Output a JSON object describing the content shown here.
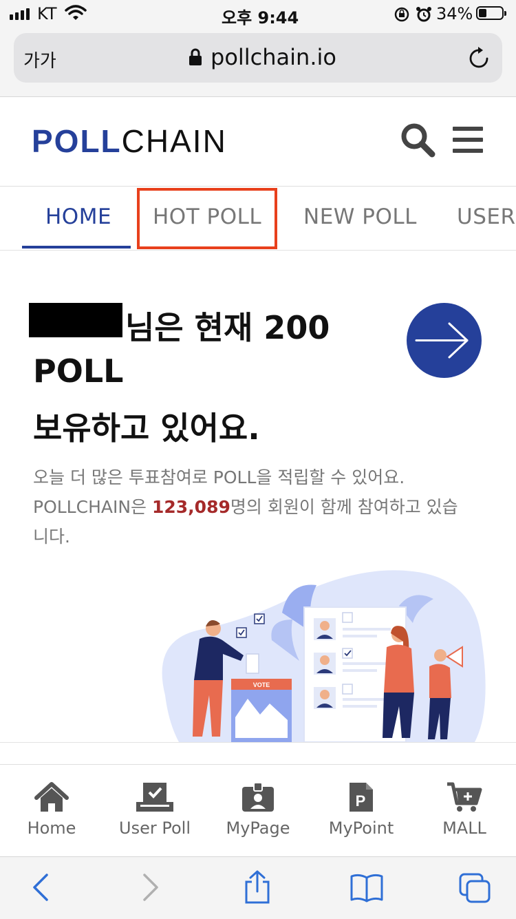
{
  "status_bar": {
    "carrier": "KT",
    "time": "오후 9:44",
    "battery_percent": "34%",
    "battery_level": 0.34
  },
  "browser": {
    "text_size_label": "가가",
    "url": "pollchain.io"
  },
  "site": {
    "logo_strong": "POLL",
    "logo_light": "CHAIN",
    "brand_color": "#25409a"
  },
  "tabs": [
    {
      "label": "HOME",
      "active": true
    },
    {
      "label": "HOT POLL",
      "active": false,
      "highlighted": true
    },
    {
      "label": "NEW POLL",
      "active": false
    },
    {
      "label": "USER",
      "active": false
    }
  ],
  "highlight_color": "#e8401c",
  "main": {
    "heading_line1": "님은 현재 200",
    "heading_line2": "POLL",
    "heading_line3": "보유하고 있어요.",
    "desc_line1": "오늘 더 많은 투표참여로 POLL을 적립할 수 있어요.",
    "desc_line2_prefix": "POLLCHAIN은 ",
    "member_count": "123,089",
    "desc_line2_suffix": "명의 회원이 함께 참여하고 있습",
    "desc_line3": "니다.",
    "vote_box_label": "VOTE"
  },
  "bottom_nav": [
    {
      "label": "Home",
      "icon": "home-icon"
    },
    {
      "label": "User Poll",
      "icon": "user-poll-icon"
    },
    {
      "label": "MyPage",
      "icon": "id-badge-icon"
    },
    {
      "label": "MyPoint",
      "icon": "point-icon"
    },
    {
      "label": "MALL",
      "icon": "cart-icon"
    }
  ]
}
